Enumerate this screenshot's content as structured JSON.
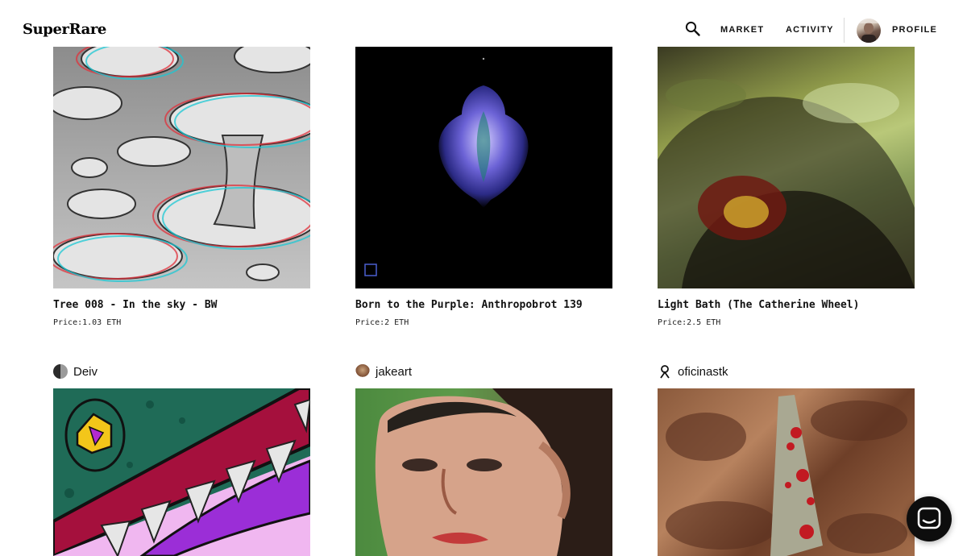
{
  "header": {
    "logo": "SuperRare",
    "nav": {
      "market": "MARKET",
      "activity": "ACTIVITY",
      "profile": "PROFILE"
    }
  },
  "icons": {
    "search": "search-icon",
    "chat": "chat-icon"
  },
  "row1": [
    {
      "title": "Tree 008 - In the sky - BW",
      "price": "Price:1.03 ETH"
    },
    {
      "title": "Born to the Purple: Anthropobrot 139",
      "price": "Price:2 ETH"
    },
    {
      "title": "Light Bath (The Catherine Wheel)",
      "price": "Price:2.5 ETH"
    }
  ],
  "row2": [
    {
      "artist": "Deiv"
    },
    {
      "artist": "jakeart"
    },
    {
      "artist": "oficinastk"
    }
  ],
  "colors": {
    "text": "#111111",
    "chat_button": "#0d0d0d"
  }
}
